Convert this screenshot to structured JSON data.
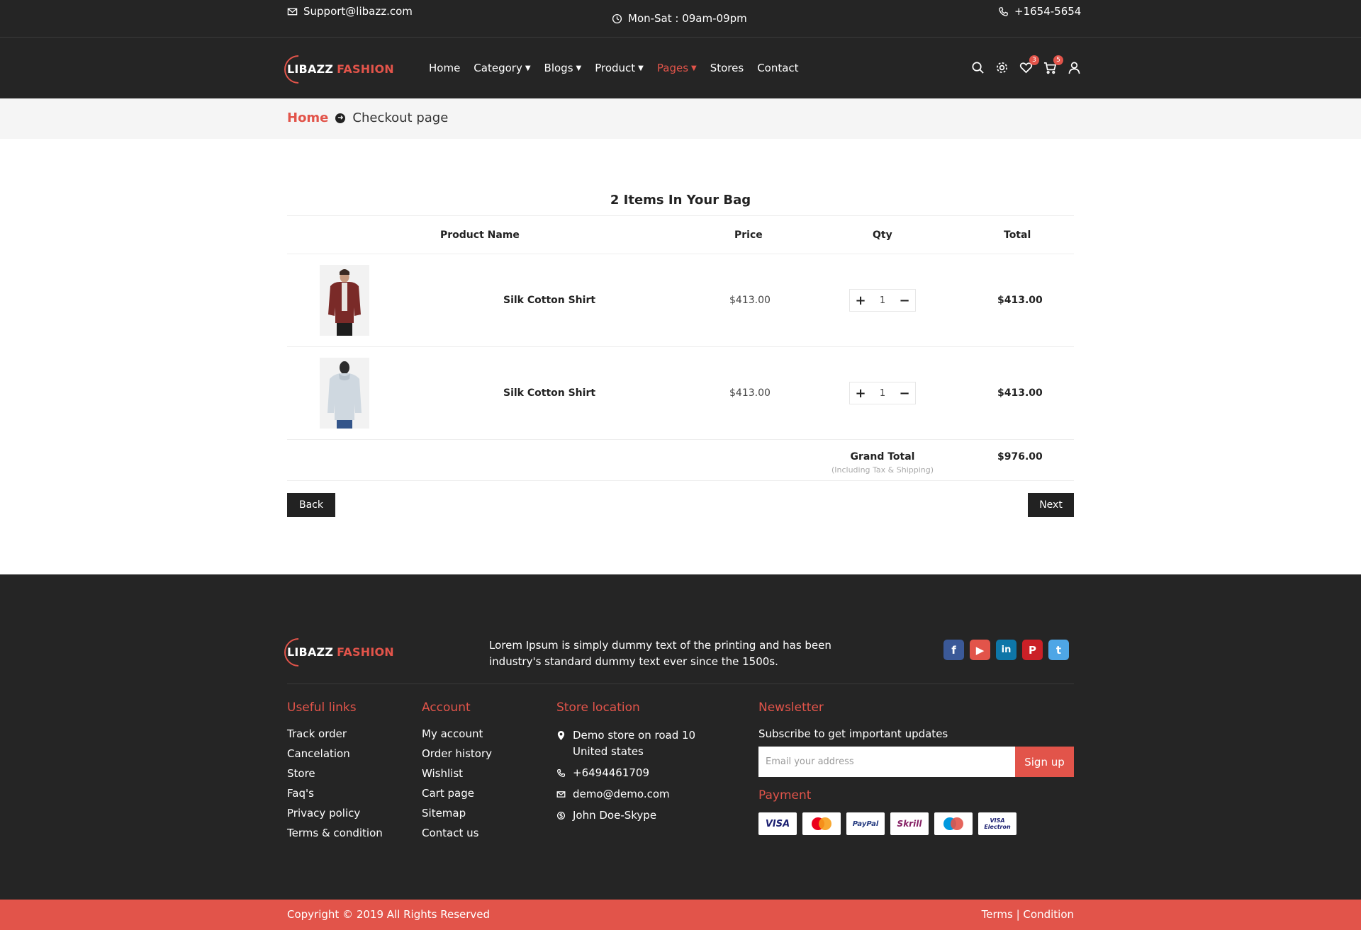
{
  "topbar": {
    "email": "Support@libazz.com",
    "hours": "Mon-Sat : 09am-09pm",
    "phone": "+1654-5654"
  },
  "brand": {
    "part1": "LIBAZZ",
    "part2": "FASHION"
  },
  "nav": [
    {
      "label": "Home",
      "dropdown": false
    },
    {
      "label": "Category",
      "dropdown": true
    },
    {
      "label": "Blogs",
      "dropdown": true
    },
    {
      "label": "Product",
      "dropdown": true
    },
    {
      "label": "Pages",
      "dropdown": true
    },
    {
      "label": "Stores",
      "dropdown": false
    },
    {
      "label": "Contact",
      "dropdown": false
    }
  ],
  "header_icons": {
    "wishlist_count": "3",
    "cart_count": "5"
  },
  "breadcrumb": {
    "home": "Home",
    "current": "Checkout page"
  },
  "cart": {
    "title": "2 Items In Your Bag",
    "columns": [
      "Product Name",
      "Price",
      "Qty",
      "Total"
    ],
    "items": [
      {
        "name": "Silk Cotton Shirt",
        "price": "$413.00",
        "qty": "1",
        "total": "$413.00"
      },
      {
        "name": "Silk Cotton Shirt",
        "price": "$413.00",
        "qty": "1",
        "total": "$413.00"
      }
    ],
    "grand_total_label": "Grand Total",
    "grand_total_sub": "(Including Tax & Shipping)",
    "grand_total": "$976.00",
    "back_label": "Back",
    "next_label": "Next"
  },
  "footer": {
    "description": "Lorem Ipsum is simply dummy text of the printing and has been industry's standard dummy text ever since the 1500s.",
    "useful_links": {
      "title": "Useful links",
      "items": [
        "Track order",
        "Cancelation",
        "Store",
        "Faq's",
        "Privacy policy",
        "Terms & condition"
      ]
    },
    "account": {
      "title": "Account",
      "items": [
        "My account",
        "Order history",
        "Wishlist",
        "Cart page",
        "Sitemap",
        "Contact us"
      ]
    },
    "store": {
      "title": "Store location",
      "address1": "Demo store on road 10",
      "address2": "United states",
      "phone": "+6494461709",
      "email": "demo@demo.com",
      "skype": "John Doe-Skype"
    },
    "newsletter": {
      "title": "Newsletter",
      "subtitle": "Subscribe to get important updates",
      "placeholder": "Email your address",
      "button": "Sign up"
    },
    "payment": {
      "title": "Payment",
      "cards": [
        "VISA",
        "MasterCard",
        "PayPal",
        "Skrill",
        "Maestro",
        "VISA Electron"
      ]
    },
    "social": [
      "facebook-icon",
      "youtube-icon",
      "linkedin-icon",
      "pinterest-icon",
      "twitter-icon"
    ],
    "copyright": "Copyright © 2019 All Rights Reserved",
    "terms": "Terms | Condition"
  },
  "colors": {
    "accent": "#e2544a",
    "dark": "#252525"
  }
}
